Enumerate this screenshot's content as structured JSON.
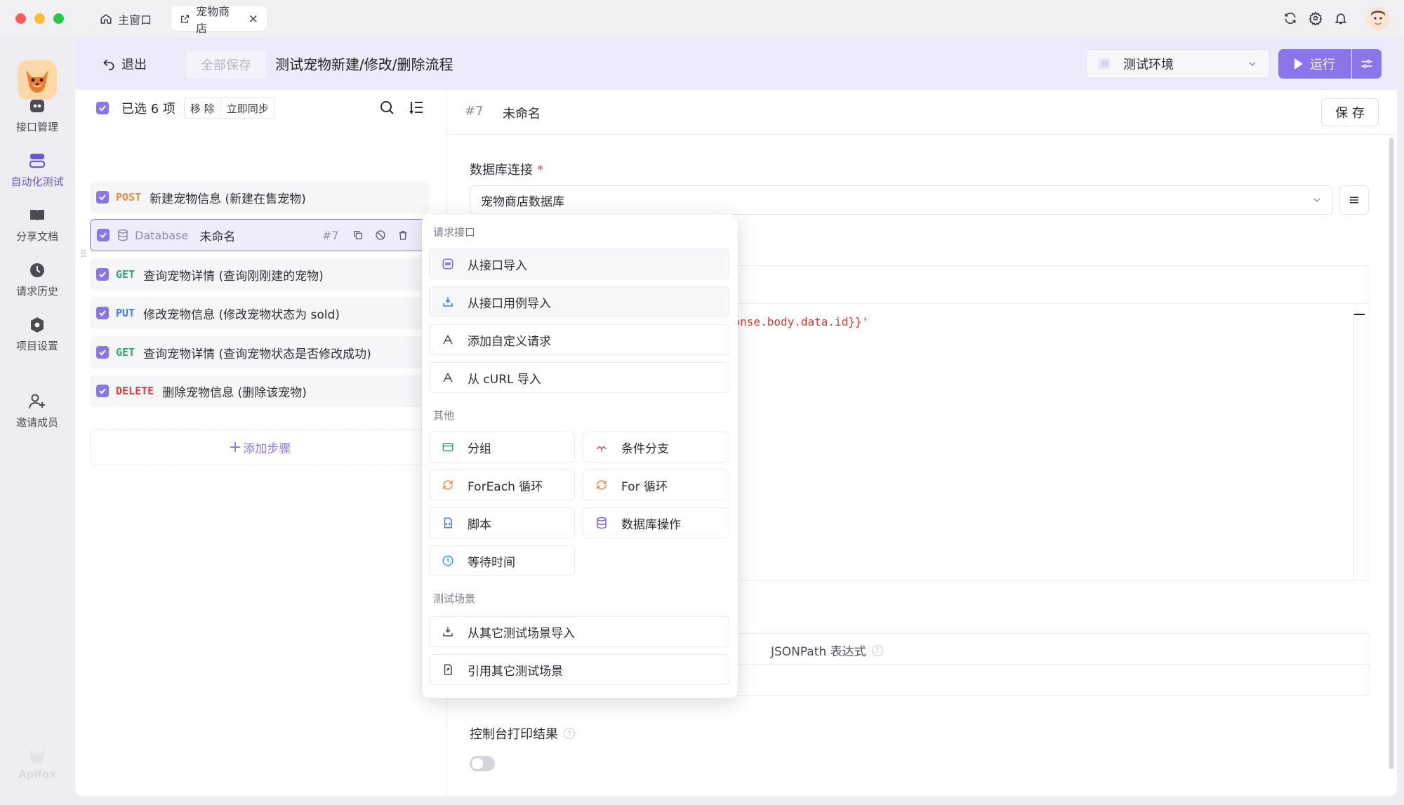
{
  "titlebar": {
    "tabs": [
      {
        "label": "主窗口"
      },
      {
        "label": "宠物商店"
      }
    ],
    "close_glyph": "×"
  },
  "sidebar": {
    "items": [
      {
        "label": "接口管理",
        "icon": "api-icon"
      },
      {
        "label": "自动化测试",
        "icon": "automation-icon",
        "active": true
      },
      {
        "label": "分享文档",
        "icon": "book-icon"
      },
      {
        "label": "请求历史",
        "icon": "clock-icon"
      },
      {
        "label": "项目设置",
        "icon": "settings-icon"
      },
      {
        "label": "邀请成员",
        "icon": "invite-icon"
      }
    ],
    "brand": "Apifox"
  },
  "header": {
    "exit_label": "退出",
    "save_all_label": "全部保存",
    "scene_title": "测试宠物新建/修改/删除流程",
    "env_badge": "测",
    "env_label": "测试环境",
    "run_label": "运行"
  },
  "steps_panel": {
    "selected_text": "已选 6 项",
    "remove_label": "移 除",
    "sync_label": "立即同步",
    "steps": [
      {
        "method": "POST",
        "name": "新建宠物信息 (新建在售宠物)"
      },
      {
        "method": "Database",
        "name": "未命名",
        "number": "#7"
      },
      {
        "method": "GET",
        "name": "查询宠物详情 (查询刚刚建的宠物)"
      },
      {
        "method": "PUT",
        "name": "修改宠物信息 (修改宠物状态为 sold)"
      },
      {
        "method": "GET",
        "name": "查询宠物详情 (查询宠物状态是否修改成功)"
      },
      {
        "method": "DELETE",
        "name": "删除宠物信息 (删除该宠物)"
      }
    ],
    "add_step_label": "添加步骤"
  },
  "editor": {
    "step_number": "#7",
    "step_name": "未命名",
    "save_label": "保 存",
    "db_connection_label": "数据库连接",
    "db_connection_value": "宠物商店数据库",
    "sql_fragment": "response.body.data.id}}'",
    "jsonpath_label": "JSONPath 表达式",
    "console_label": "控制台打印结果",
    "console_enabled": false
  },
  "dropdown": {
    "section_request": "请求接口",
    "import_from_api": "从接口导入",
    "import_from_case": "从接口用例导入",
    "add_custom_request": "添加自定义请求",
    "import_from_curl": "从 cURL 导入",
    "section_other": "其他",
    "group": "分组",
    "condition_branch": "条件分支",
    "foreach_loop": "ForEach 循环",
    "for_loop": "For 循环",
    "script": "脚本",
    "db_operation": "数据库操作",
    "wait_time": "等待时间",
    "section_scene": "测试场景",
    "import_from_scene": "从其它测试场景导入",
    "reference_scene": "引用其它测试场景"
  },
  "colors": {
    "accent": "#8b75ea",
    "post": "#f0863a",
    "get": "#2ca86a",
    "put": "#3d7be8",
    "delete": "#ea3b3b"
  }
}
